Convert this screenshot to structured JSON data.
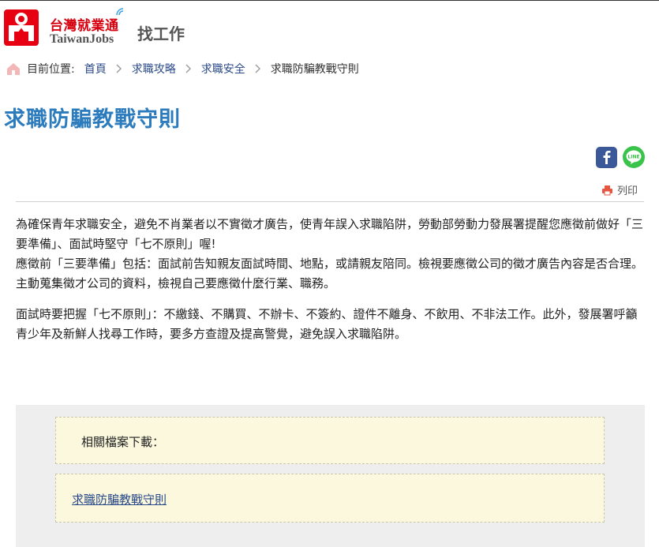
{
  "header": {
    "logo_zh": "台灣就業通",
    "logo_en": "TaiwanJobs",
    "nav_title": "找工作"
  },
  "breadcrumb": {
    "prefix": "目前位置:",
    "items": [
      "首頁",
      "求職攻略",
      "求職安全"
    ],
    "current": "求職防騙教戰守則"
  },
  "page_title": "求職防騙教戰守則",
  "share": {
    "print_label": "列印"
  },
  "content": {
    "p1": "為確保青年求職安全，避免不肖業者以不實徵才廣告，使青年誤入求職陷阱，勞動部勞動力發展署提醒您應徵前做好「三要準備」、面試時堅守「七不原則」喔!",
    "p2": "應徵前「三要準備」包括：面試前告知親友面試時間、地點，或請親友陪同。檢視要應徵公司的徵才廣告內容是否合理。主動蒐集徵才公司的資料，檢視自己要應徵什麼行業、職務。",
    "p3": "面試時要把握「七不原則」：不繳錢、不購買、不辦卡、不簽約、證件不離身、不飲用、不非法工作。此外，發展署呼籲青少年及新鮮人找尋工作時，要多方查證及提高警覺，避免誤入求職陷阱。"
  },
  "downloads": {
    "label": "相關檔案下載：",
    "file_link": "求職防騙教戰守則"
  },
  "colors": {
    "brand_red": "#e60012",
    "title_blue": "#2b7bbd",
    "link_blue": "#2b4a8a",
    "facebook": "#3b5998",
    "line": "#3ac34a",
    "print_icon": "#e8553f"
  }
}
